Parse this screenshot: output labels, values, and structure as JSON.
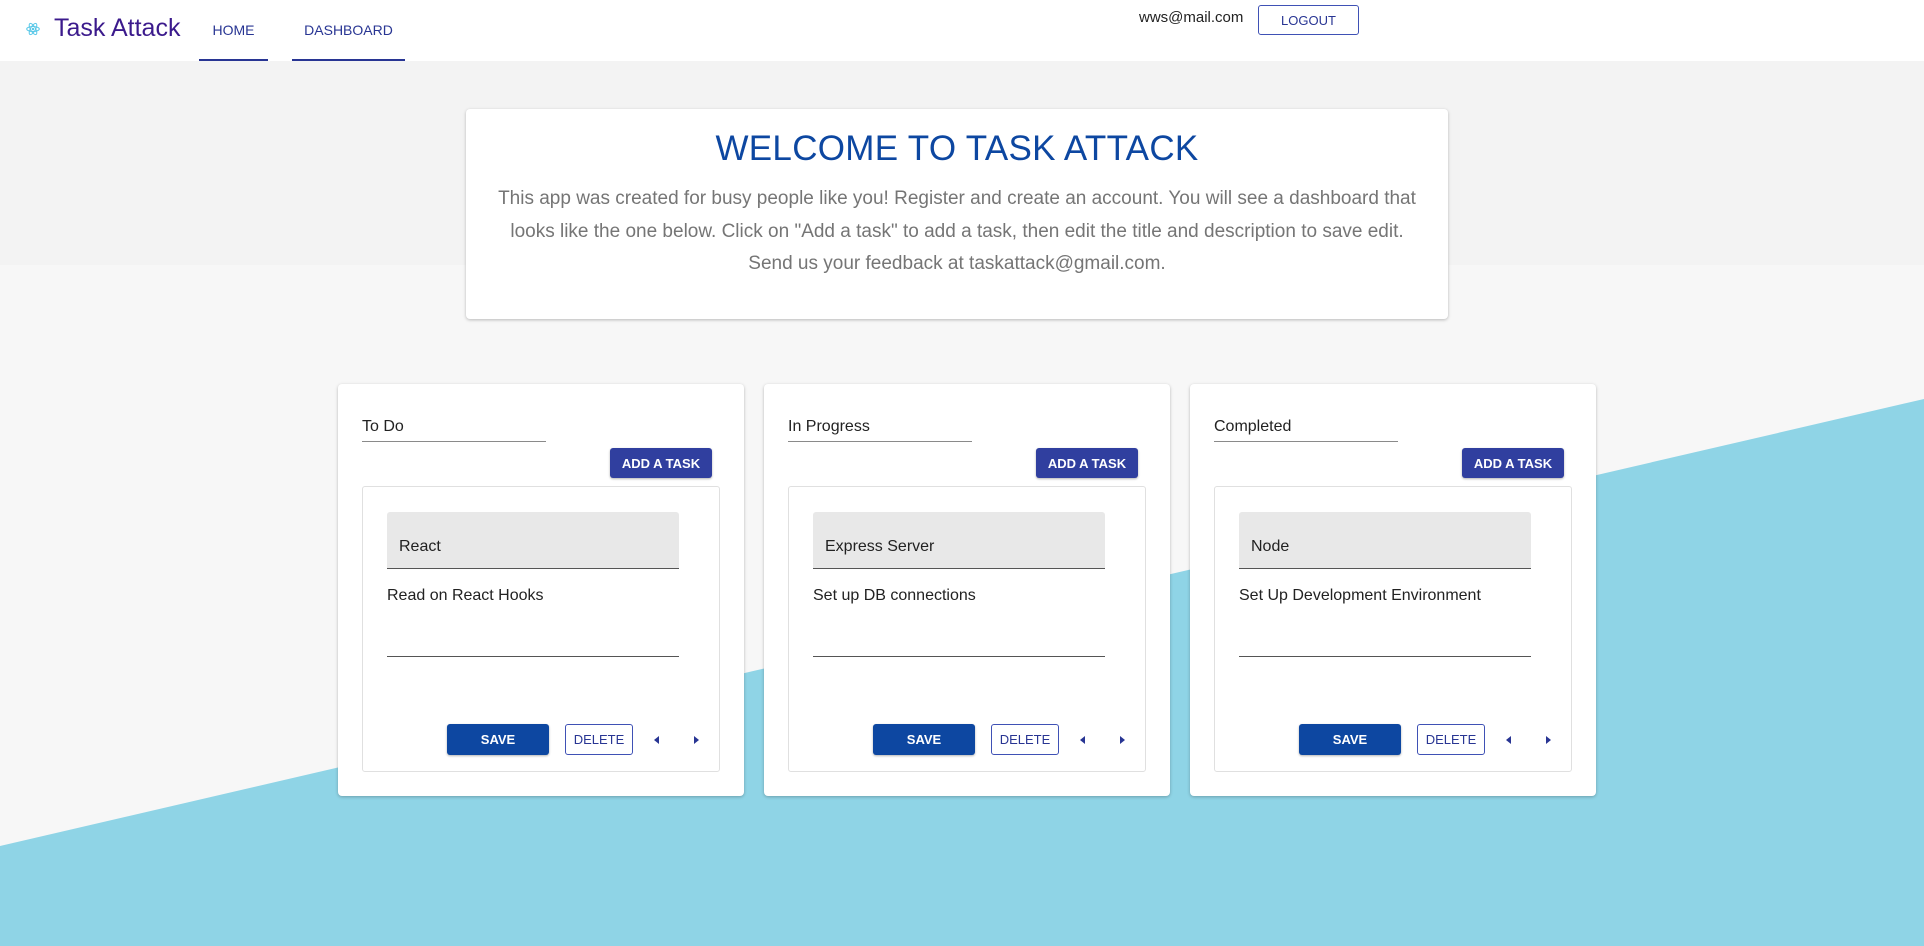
{
  "app": {
    "title": "Task Attack",
    "logo_icon": "react-atom-icon"
  },
  "nav": {
    "tabs": [
      {
        "label": "HOME"
      },
      {
        "label": "DASHBOARD"
      }
    ]
  },
  "user": {
    "email": "wws@mail.com",
    "logout_label": "LOGOUT"
  },
  "welcome": {
    "heading": "WELCOME TO TASK ATTACK",
    "body": "This app was created for busy people like you! Register and create an account. You will see a dashboard that looks like the one below. Click on \"Add a task\" to add a task, then edit the title and description to save edit. Send us your feedback at taskattack@gmail.com."
  },
  "columns": [
    {
      "title": "To Do",
      "add_label": "ADD A TASK",
      "task": {
        "title": "React",
        "description": "Read on React Hooks",
        "save_label": "SAVE",
        "delete_label": "DELETE"
      }
    },
    {
      "title": "In Progress",
      "add_label": "ADD A TASK",
      "task": {
        "title": "Express Server",
        "description": "Set up DB connections",
        "save_label": "SAVE",
        "delete_label": "DELETE"
      }
    },
    {
      "title": "Completed",
      "add_label": "ADD A TASK",
      "task": {
        "title": "Node",
        "description": "Set Up Development Environment",
        "save_label": "SAVE",
        "delete_label": "DELETE"
      }
    }
  ],
  "colors": {
    "primary": "#303f9f",
    "heading_blue": "#0d47a1",
    "brand_purple": "#3b1a8c",
    "background_light": "#f7f7f7",
    "background_top": "#f3f3f3",
    "wave_blue": "#8fd4e6"
  }
}
